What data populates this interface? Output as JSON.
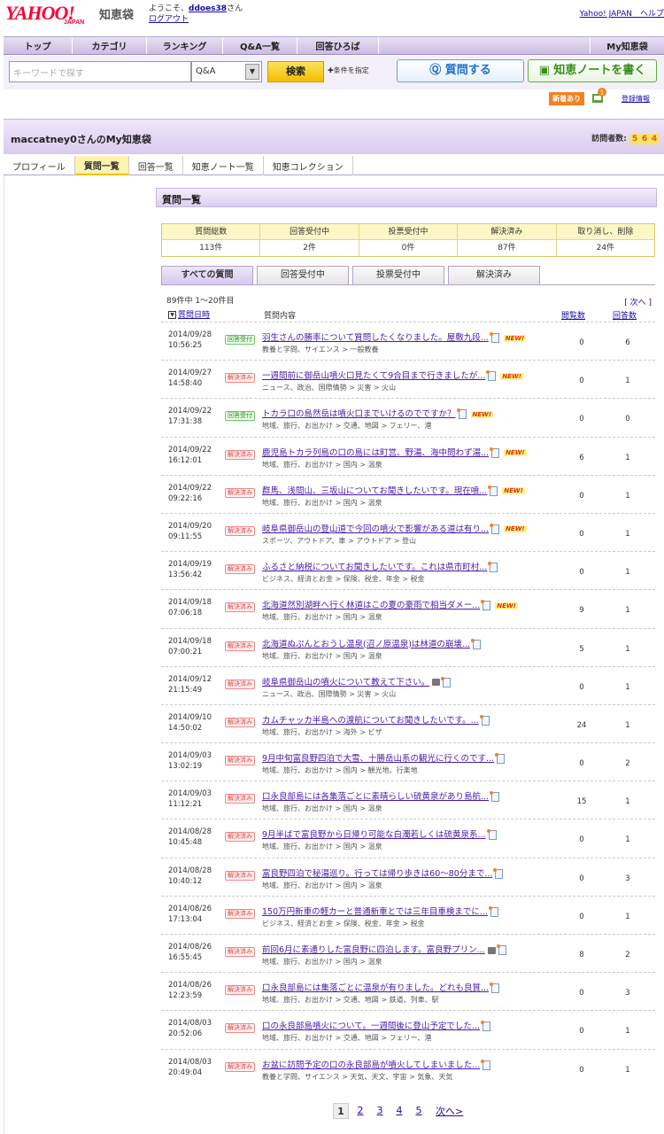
{
  "header": {
    "logo": "YAHOO!",
    "logo_sub": "JAPAN",
    "service": "知恵袋",
    "welcome_prefix": "ようこそ、",
    "username": "ddoes38",
    "welcome_suffix": "さん",
    "logout": "ログアウト",
    "top_right": "Yahoo! JAPAN　ヘルプ"
  },
  "nav": {
    "items": [
      "トップ",
      "カテゴリ",
      "ランキング",
      "Q&A一覧",
      "回答ひろば"
    ],
    "my": "My知恵袋"
  },
  "search": {
    "placeholder": "キーワードで探す",
    "scope": "Q&A",
    "button": "検索",
    "condition": "条件を指定",
    "ask_button": "質問する",
    "note_button": "知恵ノートを書く"
  },
  "notice": {
    "new_badge": "新着あり",
    "bell_count": "1",
    "register": "登録情報"
  },
  "my_page": {
    "title": "maccatney0さんのMy知恵袋",
    "visits_label": "訪問者数:",
    "visits_digits": [
      "5",
      "6",
      "4"
    ]
  },
  "subtabs": [
    "プロフィール",
    "質問一覧",
    "回答一覧",
    "知恵ノート一覧",
    "知恵コレクション"
  ],
  "section_title": "質問一覧",
  "summary": {
    "headers": [
      "質問総数",
      "回答受付中",
      "投票受付中",
      "解決済み",
      "取り消し、削除"
    ],
    "values": [
      "113件",
      "2件",
      "0件",
      "87件",
      "24件"
    ]
  },
  "filter_tabs": [
    "すべての質問",
    "回答受付中",
    "投票受付中",
    "解決済み"
  ],
  "list": {
    "count_text": "89件中 1〜20件目",
    "next_top": "[ 次へ ]",
    "col_date": "質問日時",
    "col_question": "質問内容",
    "col_views": "閲覧数",
    "col_answers": "回答数"
  },
  "rows": [
    {
      "date": "2014/09/28",
      "time": "10:56:25",
      "status": "回答受付",
      "status_kind": "open",
      "title": "羽生さんの勝率について質問したくなりました。屋敷九段...",
      "category": "教養と学問、サイエンス > 一般教養",
      "views": "0",
      "answers": "6",
      "new": "NEW!",
      "cam": false
    },
    {
      "date": "2014/09/27",
      "time": "14:58:40",
      "status": "解決済み",
      "status_kind": "solved",
      "title": "一週間前に御岳山噴火口見たくて9合目まで行きましたが...",
      "category": "ニュース、政治、国際情勢 > 災害 > 火山",
      "views": "0",
      "answers": "1",
      "new": "NEW!",
      "cam": false
    },
    {
      "date": "2014/09/22",
      "time": "17:31:38",
      "status": "回答受付",
      "status_kind": "open",
      "title": "トカラ口の島然岳は噴火口までいけるのでですか？",
      "category": "地域、旅行、お出かけ > 交通、地図 > フェリー、港",
      "views": "0",
      "answers": "0",
      "new": "NEW!",
      "cam": false
    },
    {
      "date": "2014/09/22",
      "time": "16:12:01",
      "status": "解決済み",
      "status_kind": "solved",
      "title": "鹿児島トカラ列島の口の島には町営、野湯、海中問わず湯...",
      "category": "地域、旅行、お出かけ > 国内 > 温泉",
      "views": "6",
      "answers": "1",
      "new": "NEW!",
      "cam": false
    },
    {
      "date": "2014/09/22",
      "time": "09:22:16",
      "status": "解決済み",
      "status_kind": "solved",
      "title": "群馬、浅間山、三坂山についてお聞きしたいです。現在噴...",
      "category": "地域、旅行、お出かけ > 国内 > 温泉",
      "views": "0",
      "answers": "1",
      "new": "NEW!",
      "cam": false
    },
    {
      "date": "2014/09/20",
      "time": "09:11:55",
      "status": "解決済み",
      "status_kind": "solved",
      "title": "岐阜県御岳山の登山道で今回の噴火で影響がある道は有り...",
      "category": "スポーツ、アウトドア、車 > アウトドア > 登山",
      "views": "0",
      "answers": "1",
      "new": "NEW!",
      "cam": false
    },
    {
      "date": "2014/09/19",
      "time": "13:56:42",
      "status": "解決済み",
      "status_kind": "solved",
      "title": "ふるさと納税についてお聞きしたいです。これは県市町村...",
      "category": "ビジネス、経済とお金 > 保険、税金、年金 > 税金",
      "views": "0",
      "answers": "1",
      "new": "",
      "cam": false
    },
    {
      "date": "2014/09/18",
      "time": "07:06:18",
      "status": "解決済み",
      "status_kind": "solved",
      "title": "北海道然別湖畔へ行く林道はこの夏の豪雨で相当ダメー...",
      "category": "地域、旅行、お出かけ > 国内 > 温泉",
      "views": "9",
      "answers": "1",
      "new": "NEW!",
      "cam": false
    },
    {
      "date": "2014/09/18",
      "time": "07:00:21",
      "status": "解決済み",
      "status_kind": "solved",
      "title": "北海道ぬぷんとおうし温泉(沼ノ原温泉)は林道の崩壊...",
      "category": "地域、旅行、お出かけ > 国内 > 温泉",
      "views": "5",
      "answers": "1",
      "new": "",
      "cam": false
    },
    {
      "date": "2014/09/12",
      "time": "21:15:49",
      "status": "解決済み",
      "status_kind": "solved",
      "title": "岐阜県御岳山の噴火について教えて下さい。",
      "category": "ニュース、政治、国際情勢 > 災害 > 火山",
      "views": "0",
      "answers": "1",
      "new": "",
      "cam": true
    },
    {
      "date": "2014/09/10",
      "time": "14:50:02",
      "status": "解決済み",
      "status_kind": "solved",
      "title": "カムチャッカ半島への渡航についてお聞きしたいです。...",
      "category": "地域、旅行、お出かけ > 海外 > ビザ",
      "views": "24",
      "answers": "1",
      "new": "",
      "cam": false
    },
    {
      "date": "2014/09/03",
      "time": "13:02:19",
      "status": "解決済み",
      "status_kind": "solved",
      "title": "9月中旬富良野四泊で大雪、十勝岳山系の観光に行くのです...",
      "category": "地域、旅行、お出かけ > 国内 > 観光地、行楽地",
      "views": "0",
      "answers": "2",
      "new": "",
      "cam": false
    },
    {
      "date": "2014/09/03",
      "time": "11:12:21",
      "status": "解決済み",
      "status_kind": "solved",
      "title": "口永良部島には各集落ごとに素晴らしい硫黄泉があり島航...",
      "category": "地域、旅行、お出かけ > 国内 > 温泉",
      "views": "15",
      "answers": "1",
      "new": "",
      "cam": false
    },
    {
      "date": "2014/08/28",
      "time": "10:45:48",
      "status": "解決済み",
      "status_kind": "solved",
      "title": "9月半ばで富良野から日帰り可能な白濁若しくは硫黄泉系...",
      "category": "地域、旅行、お出かけ > 国内 > 温泉",
      "views": "0",
      "answers": "1",
      "new": "",
      "cam": false
    },
    {
      "date": "2014/08/28",
      "time": "10:40:12",
      "status": "解決済み",
      "status_kind": "solved",
      "title": "富良野四泊で秘湯巡り。行っては帰り歩きは60〜80分まで...",
      "category": "地域、旅行、お出かけ > 国内 > 温泉",
      "views": "0",
      "answers": "3",
      "new": "",
      "cam": false
    },
    {
      "date": "2014/08/26",
      "time": "17:13:04",
      "status": "解決済み",
      "status_kind": "solved",
      "title": "150万円新車の軽カーと普通新車とでは三年目車検までに...",
      "category": "ビジネス、経済とお金 > 保険、税金、年金 > 税金",
      "views": "0",
      "answers": "1",
      "new": "",
      "cam": false
    },
    {
      "date": "2014/08/26",
      "time": "16:55:45",
      "status": "解決済み",
      "status_kind": "solved",
      "title": "前回6月に素通りした富良野に四泊します。富良野プリン...",
      "category": "地域、旅行、お出かけ > 国内 > 温泉",
      "views": "8",
      "answers": "2",
      "new": "",
      "cam": true
    },
    {
      "date": "2014/08/26",
      "time": "12:23:59",
      "status": "解決済み",
      "status_kind": "solved",
      "title": "口永良部島には集落ごとに温泉が有りました。どれも良質...",
      "category": "地域、旅行、お出かけ > 交通、地図 > 鉄道、列車、駅",
      "views": "0",
      "answers": "3",
      "new": "",
      "cam": false
    },
    {
      "date": "2014/08/03",
      "time": "20:52:06",
      "status": "解決済み",
      "status_kind": "solved",
      "title": "口の永良部島噴火について。一週間後に登山予定でした...",
      "category": "地域、旅行、お出かけ > 交通、地図 > フェリー、港",
      "views": "0",
      "answers": "1",
      "new": "",
      "cam": false
    },
    {
      "date": "2014/08/03",
      "time": "20:49:04",
      "status": "解決済み",
      "status_kind": "solved",
      "title": "お盆に訪問予定の口の永良部島が噴火してしまいました...",
      "category": "教養と学問、サイエンス > 天気、天文、宇宙 > 気象、天気",
      "views": "0",
      "answers": "1",
      "new": "",
      "cam": false
    }
  ],
  "pager": {
    "pages": [
      "1",
      "2",
      "3",
      "4",
      "5"
    ],
    "current": "1",
    "next": "次へ>"
  }
}
